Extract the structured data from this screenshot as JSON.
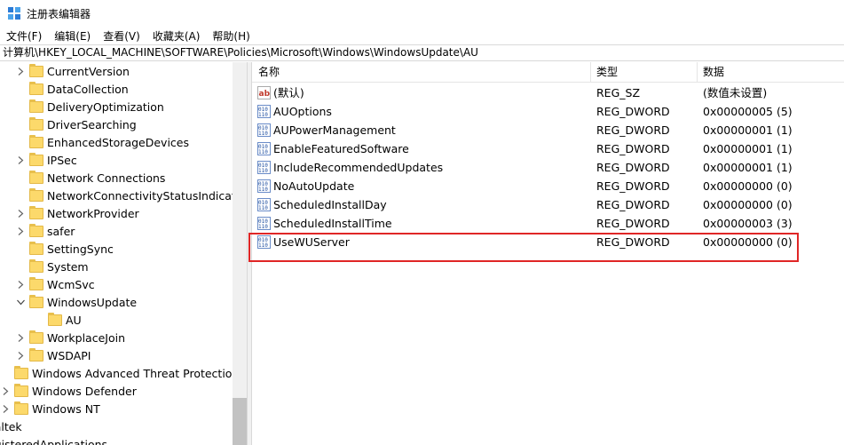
{
  "window": {
    "title": "注册表编辑器"
  },
  "menu": [
    "文件(F)",
    "编辑(E)",
    "查看(V)",
    "收藏夹(A)",
    "帮助(H)"
  ],
  "address": "计算机\\HKEY_LOCAL_MACHINE\\SOFTWARE\\Policies\\Microsoft\\Windows\\WindowsUpdate\\AU",
  "tree": [
    {
      "label": "CurrentVersion",
      "chevron": ">",
      "level": 1
    },
    {
      "label": "DataCollection",
      "chevron": "",
      "level": 1
    },
    {
      "label": "DeliveryOptimization",
      "chevron": "",
      "level": 1
    },
    {
      "label": "DriverSearching",
      "chevron": "",
      "level": 1
    },
    {
      "label": "EnhancedStorageDevices",
      "chevron": "",
      "level": 1
    },
    {
      "label": "IPSec",
      "chevron": ">",
      "level": 1
    },
    {
      "label": "Network Connections",
      "chevron": "",
      "level": 1
    },
    {
      "label": "NetworkConnectivityStatusIndicator",
      "chevron": "",
      "level": 1
    },
    {
      "label": "NetworkProvider",
      "chevron": ">",
      "level": 1
    },
    {
      "label": "safer",
      "chevron": ">",
      "level": 1
    },
    {
      "label": "SettingSync",
      "chevron": "",
      "level": 1
    },
    {
      "label": "System",
      "chevron": "",
      "level": 1
    },
    {
      "label": "WcmSvc",
      "chevron": ">",
      "level": 1
    },
    {
      "label": "WindowsUpdate",
      "chevron": "v",
      "level": 1
    },
    {
      "label": "AU",
      "chevron": "",
      "level": 2
    },
    {
      "label": "WorkplaceJoin",
      "chevron": ">",
      "level": 1
    },
    {
      "label": "WSDAPI",
      "chevron": ">",
      "level": 1
    },
    {
      "label": "Windows Advanced Threat Protection",
      "chevron": "",
      "level": 0
    },
    {
      "label": "Windows Defender",
      "chevron": ">",
      "level": 0
    },
    {
      "label": "Windows NT",
      "chevron": ">",
      "level": 0
    },
    {
      "label": "ealtek",
      "chevron": "",
      "level": -1
    },
    {
      "label": "egisteredApplications",
      "chevron": "",
      "level": -1
    }
  ],
  "columns": {
    "name": "名称",
    "type": "类型",
    "data": "数据"
  },
  "values": [
    {
      "name": "(默认)",
      "type": "REG_SZ",
      "data": "(数值未设置)",
      "icon": "string-value-icon"
    },
    {
      "name": "AUOptions",
      "type": "REG_DWORD",
      "data": "0x00000005 (5)",
      "icon": "dword-value-icon"
    },
    {
      "name": "AUPowerManagement",
      "type": "REG_DWORD",
      "data": "0x00000001 (1)",
      "icon": "dword-value-icon"
    },
    {
      "name": "EnableFeaturedSoftware",
      "type": "REG_DWORD",
      "data": "0x00000001 (1)",
      "icon": "dword-value-icon"
    },
    {
      "name": "IncludeRecommendedUpdates",
      "type": "REG_DWORD",
      "data": "0x00000001 (1)",
      "icon": "dword-value-icon"
    },
    {
      "name": "NoAutoUpdate",
      "type": "REG_DWORD",
      "data": "0x00000000 (0)",
      "icon": "dword-value-icon"
    },
    {
      "name": "ScheduledInstallDay",
      "type": "REG_DWORD",
      "data": "0x00000000 (0)",
      "icon": "dword-value-icon"
    },
    {
      "name": "ScheduledInstallTime",
      "type": "REG_DWORD",
      "data": "0x00000003 (3)",
      "icon": "dword-value-icon"
    },
    {
      "name": "UseWUServer",
      "type": "REG_DWORD",
      "data": "0x00000000 (0)",
      "icon": "dword-value-icon"
    }
  ],
  "colors": {
    "highlight": "#e02626",
    "folder": "#fcd96b"
  }
}
